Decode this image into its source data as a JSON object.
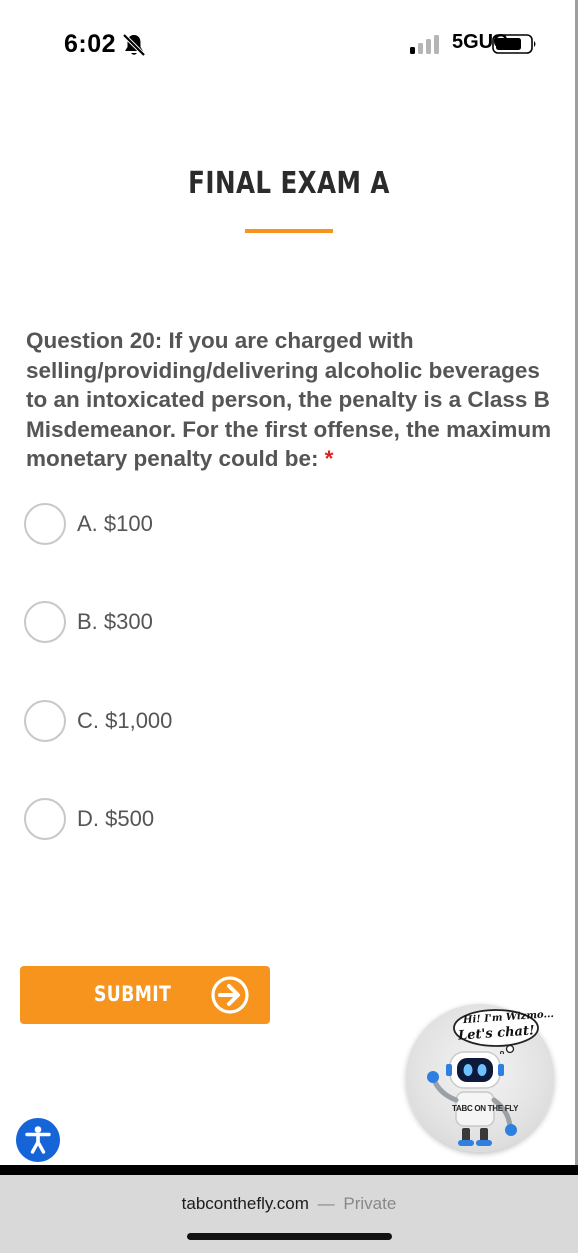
{
  "status_bar": {
    "time": "6:02",
    "network": "5GUC",
    "bell_icon": "bell-slash-icon",
    "signal_icon": "cellular-signal-icon",
    "battery_icon": "battery-icon"
  },
  "exam": {
    "title": "FINAL EXAM A",
    "accent_color": "#f7941d"
  },
  "question": {
    "text": "Question 20: If you are charged with selling/providing/delivering alcoholic beverages to an intoxicated person, the penalty is a Class B Misdemeanor. For the first offense, the maximum monetary penalty could be:",
    "required_marker": "*"
  },
  "options": [
    {
      "label": "A. $100"
    },
    {
      "label": "B. $300"
    },
    {
      "label": "C. $1,000"
    },
    {
      "label": "D. $500"
    }
  ],
  "submit": {
    "label": "SUBMIT",
    "icon": "arrow-right-circle-icon"
  },
  "chatbot": {
    "greeting_line1": "Hi! I'm Wizmo...",
    "greeting_line2": "Let's chat!",
    "badge": "TABC ON THE FLY"
  },
  "accessibility": {
    "icon": "accessibility-icon",
    "color": "#1565d8"
  },
  "browser": {
    "domain": "tabconthefly.com",
    "separator": "—",
    "mode": "Private"
  }
}
